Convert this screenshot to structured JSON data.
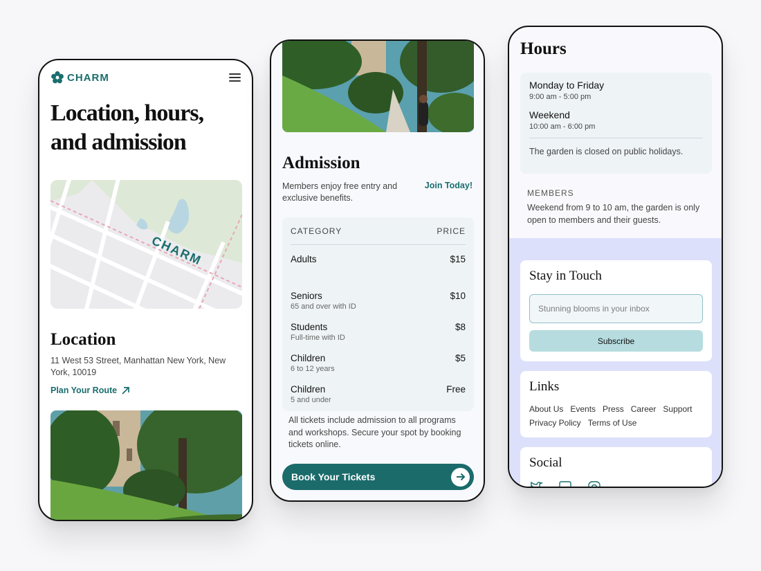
{
  "brand": {
    "name": "CHARM",
    "accent": "#1a6e6e"
  },
  "page1": {
    "headline": "Location, hours, and admission",
    "map_label": "CHARM",
    "location_title": "Location",
    "address": "11 West 53 Street, Manhattan New York, New York, 10019",
    "route_link": "Plan Your Route"
  },
  "page2": {
    "admission_title": "Admission",
    "admission_desc": "Members enjoy free entry and exclusive benefits.",
    "join_link": "Join Today!",
    "table": {
      "headers": {
        "category": "CATEGORY",
        "price": "PRICE"
      },
      "rows": [
        {
          "name": "Adults",
          "sub": "",
          "price": "$15"
        },
        {
          "name": "Seniors",
          "sub": "65 and over with ID",
          "price": "$10"
        },
        {
          "name": "Students",
          "sub": "Full-time with ID",
          "price": "$8"
        },
        {
          "name": "Children",
          "sub": "6 to 12 years",
          "price": "$5"
        },
        {
          "name": "Children",
          "sub": "5 and under",
          "price": "Free"
        }
      ]
    },
    "note": "All tickets include admission to all programs and workshops. Secure your spot by booking tickets online.",
    "book_button": "Book Your Tickets"
  },
  "page3": {
    "hours_title": "Hours",
    "weekday": {
      "label": "Monday to Friday",
      "time": "9:00 am - 5:00 pm"
    },
    "weekend": {
      "label": "Weekend",
      "time": "10:00 am - 6:00 pm"
    },
    "closed_note": "The garden is closed on public holidays.",
    "members_label": "MEMBERS",
    "members_text": "Weekend from 9 to 10 am, the garden is only open to members and their guests.",
    "stay_title": "Stay in Touch",
    "email_placeholder": "Stunning blooms in your inbox",
    "subscribe": "Subscribe",
    "links_title": "Links",
    "links": [
      "About Us",
      "Events",
      "Press",
      "Career",
      "Support",
      "Privacy Policy",
      "Terms of Use"
    ],
    "social_title": "Social",
    "social_icons": [
      "twitter-icon",
      "linkedin-icon",
      "instagram-icon"
    ]
  }
}
